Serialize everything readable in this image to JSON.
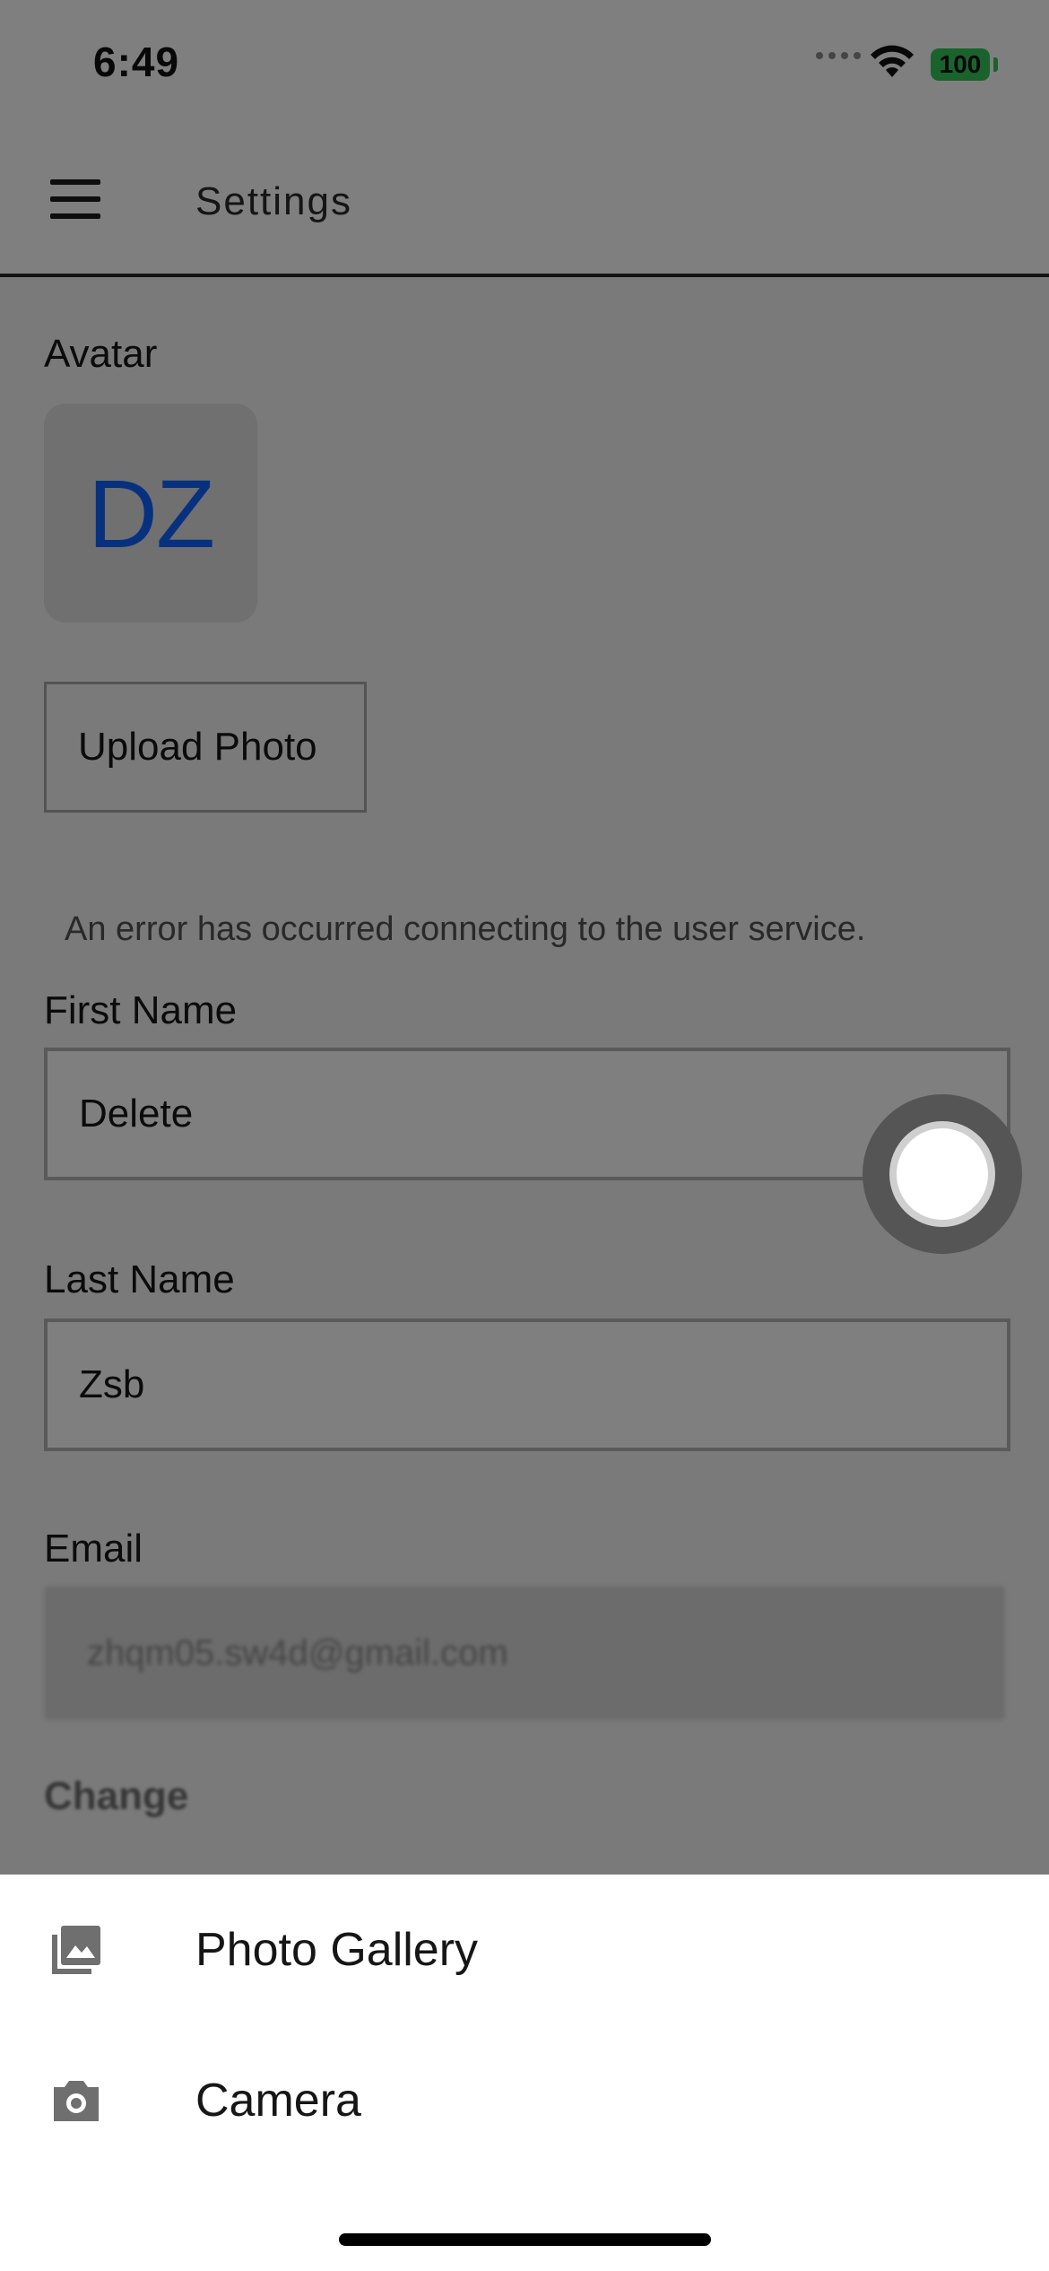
{
  "status_bar": {
    "time": "6:49",
    "battery": "100",
    "battery_color": "#34c759"
  },
  "header": {
    "title": "Settings",
    "menu_icon": "hamburger-icon"
  },
  "profile": {
    "avatar_label": "Avatar",
    "avatar_initials": "DZ",
    "avatar_initials_color": "#0f62fe",
    "upload_button": "Upload Photo",
    "error_message": "An error has occurred connecting to the user service.",
    "first_name_label": "First Name",
    "first_name_value": "Delete",
    "last_name_label": "Last Name",
    "last_name_value": "Zsb",
    "email_label": "Email",
    "email_value": "zhqm05.sw4d@gmail.com",
    "change_link": "Change"
  },
  "action_sheet": {
    "items": [
      {
        "label": "Photo Gallery",
        "icon": "photo-gallery-icon"
      },
      {
        "label": "Camera",
        "icon": "camera-icon"
      }
    ]
  }
}
